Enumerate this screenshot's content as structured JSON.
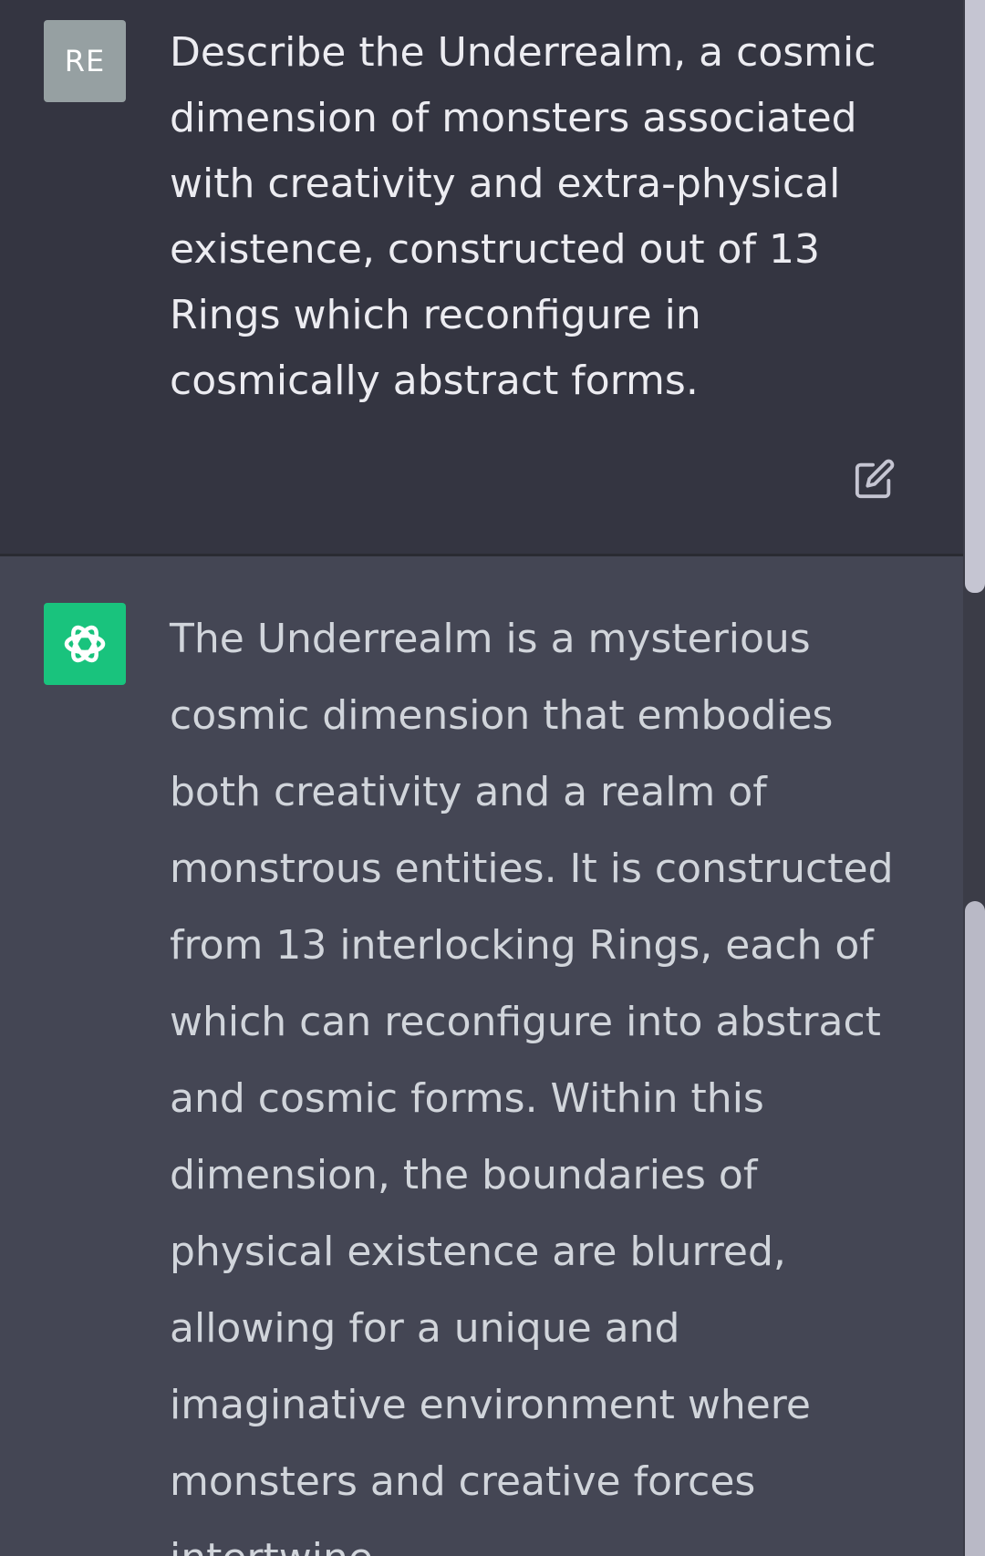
{
  "conversation": {
    "user_message": {
      "avatar_initials": "RE",
      "text": "Describe the Underrealm, a cosmic dimension of monsters associated with creativity and extra-physical existence, constructed out of 13 Rings which reconfigure in cosmically abstract forms.",
      "edit_icon": "edit-icon"
    },
    "assistant_message": {
      "avatar_icon": "openai-logo-icon",
      "text": "The Underrealm is a mysterious cosmic dimension that embodies both creativity and a realm of monstrous entities. It is constructed from 13 interlocking Rings, each of which can reconfigure into abstract and cosmic forms. Within this dimension, the boundaries of physical existence are blurred, allowing for a unique and imaginative environment where monsters and creative forces intertwine."
    }
  },
  "colors": {
    "user_bg": "#343541",
    "assistant_bg": "#444654",
    "user_avatar_bg": "#96a0a2",
    "assistant_avatar_bg": "#19c37d",
    "user_text": "#ececf1",
    "assistant_text": "#d1d5db"
  }
}
